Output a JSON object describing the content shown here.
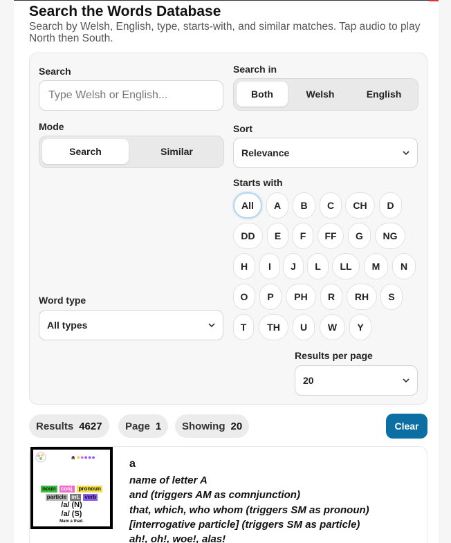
{
  "header": {
    "title": "Search the Words Database",
    "subtitle": "Search by Welsh, English, type, starts-with, and similar matches. Tap audio to play North then South."
  },
  "search": {
    "label": "Search",
    "placeholder": "Type Welsh or English..."
  },
  "search_in": {
    "label": "Search in",
    "options": [
      "Both",
      "Welsh",
      "English"
    ],
    "selected": "Both"
  },
  "mode": {
    "label": "Mode",
    "options": [
      "Search",
      "Similar"
    ],
    "selected": "Search"
  },
  "sort": {
    "label": "Sort",
    "value": "Relevance"
  },
  "starts_with": {
    "label": "Starts with",
    "letters": [
      "All",
      "A",
      "B",
      "C",
      "CH",
      "D",
      "DD",
      "E",
      "F",
      "FF",
      "G",
      "NG",
      "H",
      "I",
      "J",
      "L",
      "LL",
      "M",
      "N",
      "O",
      "P",
      "PH",
      "R",
      "RH",
      "S",
      "T",
      "TH",
      "U",
      "W",
      "Y"
    ],
    "selected": "All"
  },
  "word_type": {
    "label": "Word type",
    "value": "All types"
  },
  "results_per_page": {
    "label": "Results per page",
    "value": "20"
  },
  "stats": {
    "results_label": "Results",
    "results_value": "4627",
    "page_label": "Page",
    "page_value": "1",
    "showing_label": "Showing",
    "showing_value": "20"
  },
  "clear_label": "Clear",
  "result": {
    "word": "a",
    "definitions": [
      "name of letter A",
      "and (triggers AM as comnjunction)",
      "that, which, who whom (triggers SM as pronoun)",
      "[interrogative particle] (triggers SM as particle)",
      "ah!, oh!, woe!, alas!"
    ],
    "thumbnail": {
      "letter": "a",
      "tags_row1": [
        "noun",
        "conj.",
        "pronoun"
      ],
      "tags_row2": [
        "particle",
        "int.",
        "verb"
      ],
      "pron_north": "/a/ (N)",
      "pron_south": "/a/ (S)",
      "caption": "Mam a thad.",
      "colors": {
        "noun": "#3cc13c",
        "conj": "#f06bc8",
        "pronoun": "#f4e04a",
        "particle": "#b9b9b9",
        "int": "#777777",
        "verb": "#8b5cf6"
      }
    }
  },
  "colors": {
    "accent": "#0b6fa4",
    "panel_bg": "#f7f7f7",
    "pill_bg": "#ececec"
  }
}
